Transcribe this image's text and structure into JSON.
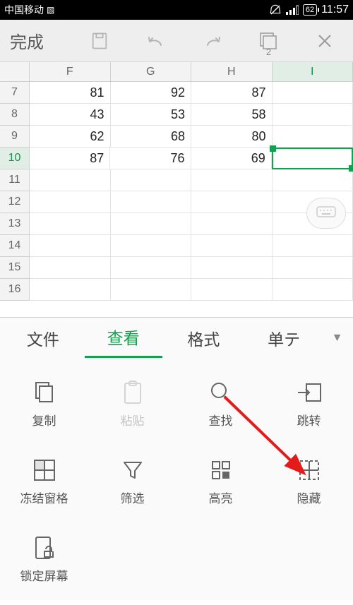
{
  "status": {
    "carrier": "中国移动",
    "battery": "62",
    "time": "11:57"
  },
  "toolbar": {
    "done": "完成",
    "pages": "2"
  },
  "sheet": {
    "columns": [
      "F",
      "G",
      "H",
      "I"
    ],
    "active_column_index": 3,
    "row_start": 7,
    "active_row_index": 3,
    "rows": [
      {
        "n": "7",
        "cells": [
          "81",
          "92",
          "87",
          ""
        ]
      },
      {
        "n": "8",
        "cells": [
          "43",
          "53",
          "58",
          ""
        ]
      },
      {
        "n": "9",
        "cells": [
          "62",
          "68",
          "80",
          ""
        ]
      },
      {
        "n": "10",
        "cells": [
          "87",
          "76",
          "69",
          ""
        ]
      },
      {
        "n": "11",
        "cells": [
          "",
          "",
          "",
          ""
        ]
      },
      {
        "n": "12",
        "cells": [
          "",
          "",
          "",
          ""
        ]
      },
      {
        "n": "13",
        "cells": [
          "",
          "",
          "",
          ""
        ]
      },
      {
        "n": "14",
        "cells": [
          "",
          "",
          "",
          ""
        ]
      },
      {
        "n": "15",
        "cells": [
          "",
          "",
          "",
          ""
        ]
      },
      {
        "n": "16",
        "cells": [
          "",
          "",
          "",
          ""
        ]
      }
    ],
    "selected": {
      "row": 3,
      "col": 3
    }
  },
  "tabs": {
    "items": [
      "文件",
      "查看",
      "格式",
      "单元"
    ],
    "display": [
      "文件",
      "查看",
      "格式",
      "单テ"
    ],
    "active": 1
  },
  "tools": {
    "items": [
      {
        "key": "copy",
        "label": "复制"
      },
      {
        "key": "paste",
        "label": "粘贴",
        "disabled": true
      },
      {
        "key": "find",
        "label": "查找"
      },
      {
        "key": "goto",
        "label": "跳转"
      },
      {
        "key": "freeze",
        "label": "冻结窗格"
      },
      {
        "key": "filter",
        "label": "筛选"
      },
      {
        "key": "highlight",
        "label": "高亮"
      },
      {
        "key": "hide",
        "label": "隐藏"
      },
      {
        "key": "lock",
        "label": "锁定屏幕"
      }
    ]
  },
  "annotation": {
    "arrow_target": "hide"
  }
}
